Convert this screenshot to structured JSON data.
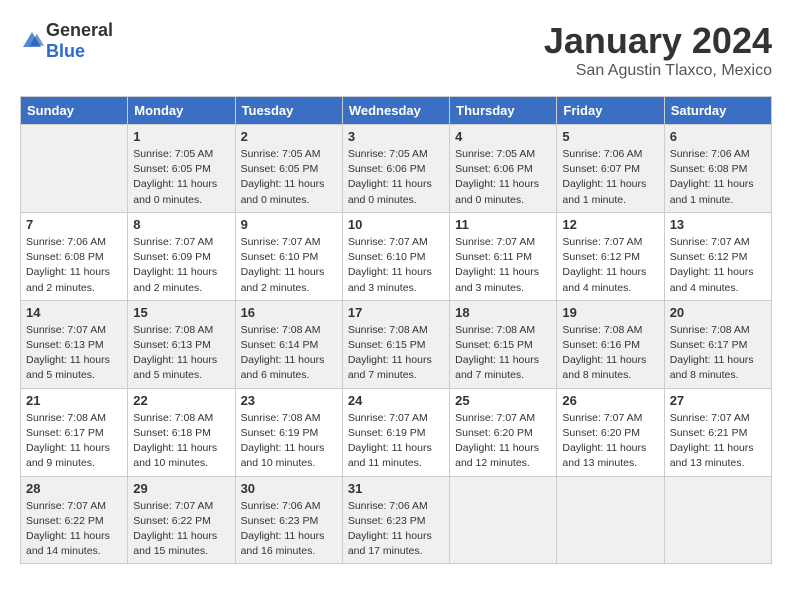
{
  "logo": {
    "general": "General",
    "blue": "Blue"
  },
  "header": {
    "month": "January 2024",
    "location": "San Agustin Tlaxco, Mexico"
  },
  "weekdays": [
    "Sunday",
    "Monday",
    "Tuesday",
    "Wednesday",
    "Thursday",
    "Friday",
    "Saturday"
  ],
  "weeks": [
    [
      {
        "day": "",
        "info": ""
      },
      {
        "day": "1",
        "info": "Sunrise: 7:05 AM\nSunset: 6:05 PM\nDaylight: 11 hours\nand 0 minutes."
      },
      {
        "day": "2",
        "info": "Sunrise: 7:05 AM\nSunset: 6:05 PM\nDaylight: 11 hours\nand 0 minutes."
      },
      {
        "day": "3",
        "info": "Sunrise: 7:05 AM\nSunset: 6:06 PM\nDaylight: 11 hours\nand 0 minutes."
      },
      {
        "day": "4",
        "info": "Sunrise: 7:05 AM\nSunset: 6:06 PM\nDaylight: 11 hours\nand 0 minutes."
      },
      {
        "day": "5",
        "info": "Sunrise: 7:06 AM\nSunset: 6:07 PM\nDaylight: 11 hours\nand 1 minute."
      },
      {
        "day": "6",
        "info": "Sunrise: 7:06 AM\nSunset: 6:08 PM\nDaylight: 11 hours\nand 1 minute."
      }
    ],
    [
      {
        "day": "7",
        "info": "Sunrise: 7:06 AM\nSunset: 6:08 PM\nDaylight: 11 hours\nand 2 minutes."
      },
      {
        "day": "8",
        "info": "Sunrise: 7:07 AM\nSunset: 6:09 PM\nDaylight: 11 hours\nand 2 minutes."
      },
      {
        "day": "9",
        "info": "Sunrise: 7:07 AM\nSunset: 6:10 PM\nDaylight: 11 hours\nand 2 minutes."
      },
      {
        "day": "10",
        "info": "Sunrise: 7:07 AM\nSunset: 6:10 PM\nDaylight: 11 hours\nand 3 minutes."
      },
      {
        "day": "11",
        "info": "Sunrise: 7:07 AM\nSunset: 6:11 PM\nDaylight: 11 hours\nand 3 minutes."
      },
      {
        "day": "12",
        "info": "Sunrise: 7:07 AM\nSunset: 6:12 PM\nDaylight: 11 hours\nand 4 minutes."
      },
      {
        "day": "13",
        "info": "Sunrise: 7:07 AM\nSunset: 6:12 PM\nDaylight: 11 hours\nand 4 minutes."
      }
    ],
    [
      {
        "day": "14",
        "info": "Sunrise: 7:07 AM\nSunset: 6:13 PM\nDaylight: 11 hours\nand 5 minutes."
      },
      {
        "day": "15",
        "info": "Sunrise: 7:08 AM\nSunset: 6:13 PM\nDaylight: 11 hours\nand 5 minutes."
      },
      {
        "day": "16",
        "info": "Sunrise: 7:08 AM\nSunset: 6:14 PM\nDaylight: 11 hours\nand 6 minutes."
      },
      {
        "day": "17",
        "info": "Sunrise: 7:08 AM\nSunset: 6:15 PM\nDaylight: 11 hours\nand 7 minutes."
      },
      {
        "day": "18",
        "info": "Sunrise: 7:08 AM\nSunset: 6:15 PM\nDaylight: 11 hours\nand 7 minutes."
      },
      {
        "day": "19",
        "info": "Sunrise: 7:08 AM\nSunset: 6:16 PM\nDaylight: 11 hours\nand 8 minutes."
      },
      {
        "day": "20",
        "info": "Sunrise: 7:08 AM\nSunset: 6:17 PM\nDaylight: 11 hours\nand 8 minutes."
      }
    ],
    [
      {
        "day": "21",
        "info": "Sunrise: 7:08 AM\nSunset: 6:17 PM\nDaylight: 11 hours\nand 9 minutes."
      },
      {
        "day": "22",
        "info": "Sunrise: 7:08 AM\nSunset: 6:18 PM\nDaylight: 11 hours\nand 10 minutes."
      },
      {
        "day": "23",
        "info": "Sunrise: 7:08 AM\nSunset: 6:19 PM\nDaylight: 11 hours\nand 10 minutes."
      },
      {
        "day": "24",
        "info": "Sunrise: 7:07 AM\nSunset: 6:19 PM\nDaylight: 11 hours\nand 11 minutes."
      },
      {
        "day": "25",
        "info": "Sunrise: 7:07 AM\nSunset: 6:20 PM\nDaylight: 11 hours\nand 12 minutes."
      },
      {
        "day": "26",
        "info": "Sunrise: 7:07 AM\nSunset: 6:20 PM\nDaylight: 11 hours\nand 13 minutes."
      },
      {
        "day": "27",
        "info": "Sunrise: 7:07 AM\nSunset: 6:21 PM\nDaylight: 11 hours\nand 13 minutes."
      }
    ],
    [
      {
        "day": "28",
        "info": "Sunrise: 7:07 AM\nSunset: 6:22 PM\nDaylight: 11 hours\nand 14 minutes."
      },
      {
        "day": "29",
        "info": "Sunrise: 7:07 AM\nSunset: 6:22 PM\nDaylight: 11 hours\nand 15 minutes."
      },
      {
        "day": "30",
        "info": "Sunrise: 7:06 AM\nSunset: 6:23 PM\nDaylight: 11 hours\nand 16 minutes."
      },
      {
        "day": "31",
        "info": "Sunrise: 7:06 AM\nSunset: 6:23 PM\nDaylight: 11 hours\nand 17 minutes."
      },
      {
        "day": "",
        "info": ""
      },
      {
        "day": "",
        "info": ""
      },
      {
        "day": "",
        "info": ""
      }
    ]
  ]
}
